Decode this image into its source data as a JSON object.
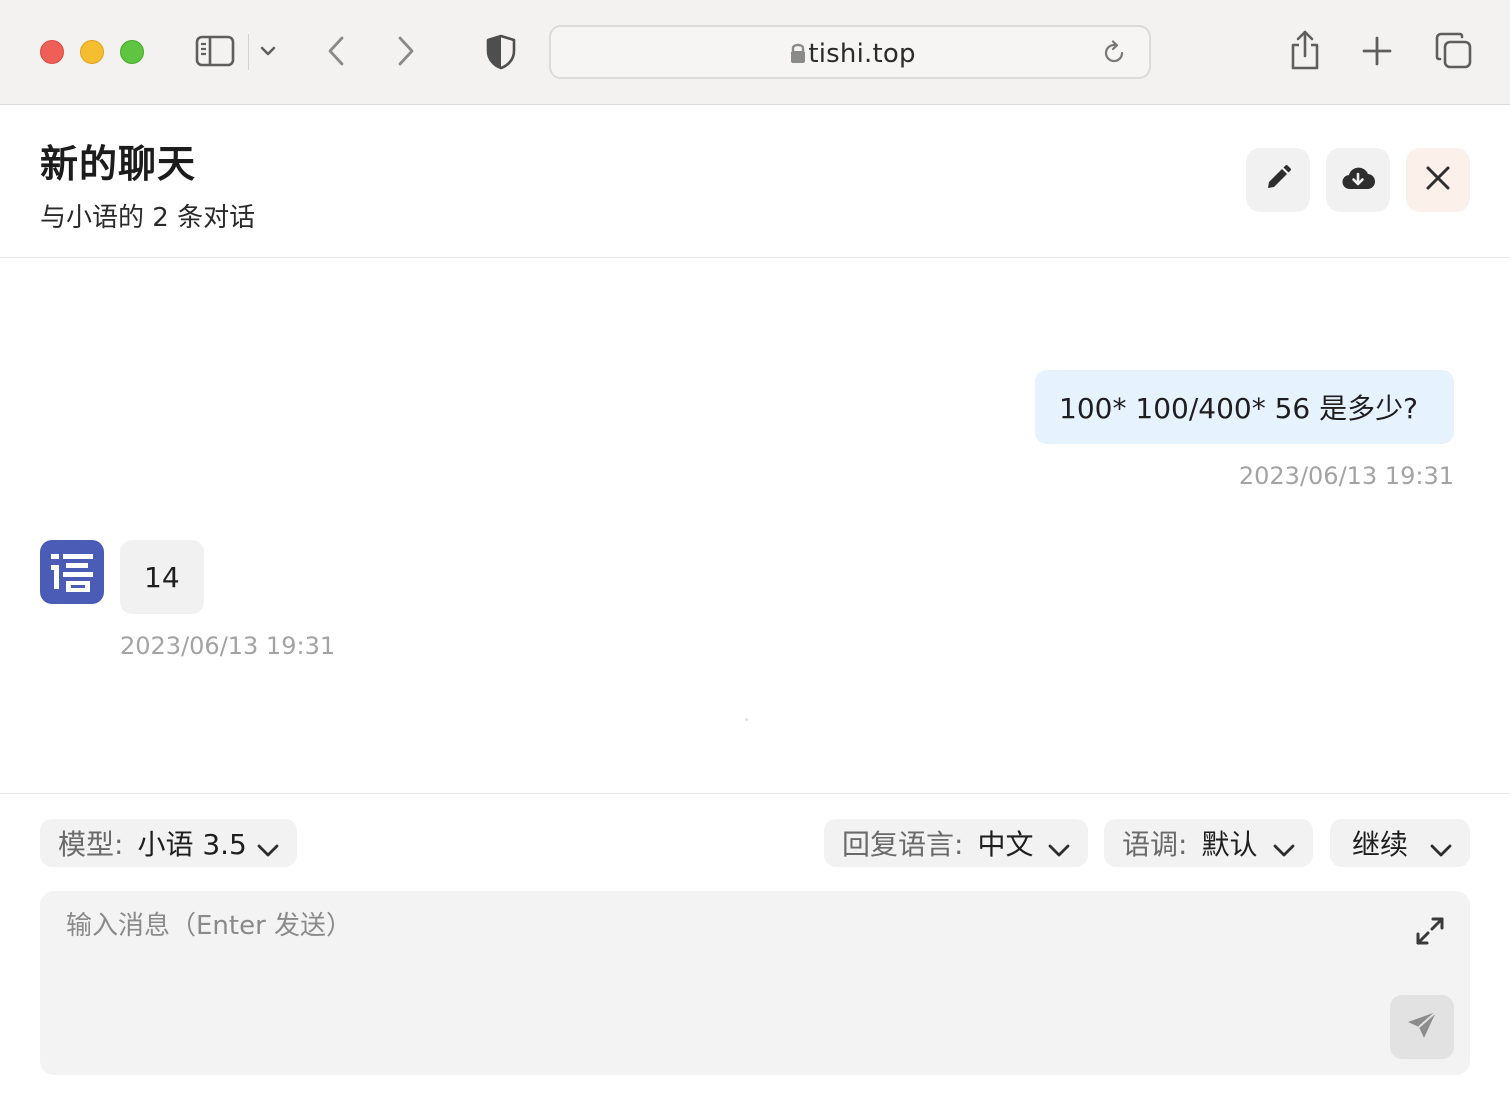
{
  "browser": {
    "url": "tishi.top",
    "icons": {
      "close": "red-traffic-light",
      "minimize": "yellow-traffic-light",
      "zoom": "green-traffic-light",
      "sidebar": "sidebar-icon",
      "back": "chevron-left-icon",
      "forward": "chevron-right-icon",
      "privacy": "shield-icon",
      "share": "share-icon",
      "new_tab": "plus-icon",
      "tabs": "tabs-overview-icon"
    }
  },
  "header": {
    "title": "新的聊天",
    "subtitle": "与小语的 2 条对话",
    "buttons": [
      "edit-icon",
      "cloud-download-icon",
      "close-icon"
    ]
  },
  "messages": [
    {
      "role": "user",
      "text": "100* 100/400* 56 是多少?",
      "time": "2023/06/13 19:31"
    },
    {
      "role": "assistant",
      "avatar_text": "语",
      "text": "14",
      "time": "2023/06/13 19:31"
    }
  ],
  "composer": {
    "model_label": "模型:",
    "model_value": "小语 3.5",
    "language_label": "回复语言:",
    "language_value": "中文",
    "tone_label": "语调:",
    "tone_value": "默认",
    "continue_value": "继续",
    "input_placeholder": "输入消息（Enter 发送）"
  },
  "colors": {
    "avatar_bg": "#4a5cb6",
    "user_bubble": "#e6f2fd",
    "bot_bubble": "#f1f1f1",
    "close_button_bg": "#fbf0ea"
  }
}
